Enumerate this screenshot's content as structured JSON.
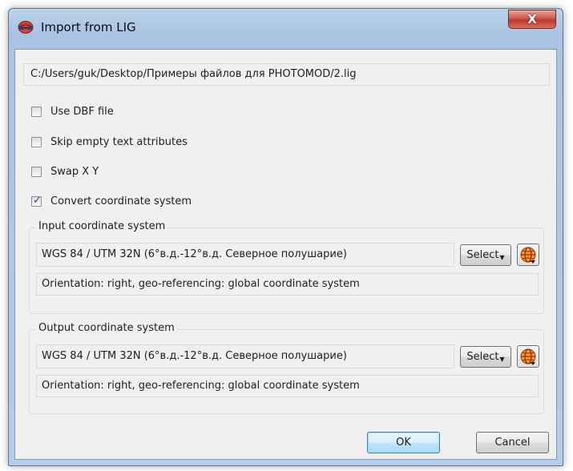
{
  "window": {
    "title": "Import from LIG",
    "close_label": "X"
  },
  "file": {
    "path": "C:/Users/guk/Desktop/Примеры файлов для PHOTOMOD/2.lig"
  },
  "options": [
    {
      "label": "Use DBF file",
      "checked": false
    },
    {
      "label": "Skip empty text attributes",
      "checked": false
    },
    {
      "label": "Swap X Y",
      "checked": false
    },
    {
      "label": "Convert coordinate system",
      "checked": true
    }
  ],
  "input_cs": {
    "group_label": "Input coordinate system",
    "value": "WGS 84 / UTM 32N (6°в.д.-12°в.д. Северное полушарие)",
    "select_label": "Select",
    "info": "Orientation: right, geo-referencing: global coordinate system"
  },
  "output_cs": {
    "group_label": "Output coordinate system",
    "value": "WGS 84 / UTM 32N (6°в.д.-12°в.д. Северное полушарие)",
    "select_label": "Select",
    "info": "Orientation: right, geo-referencing: global coordinate system"
  },
  "buttons": {
    "ok": "OK",
    "cancel": "Cancel"
  },
  "colors": {
    "accent": "#3c7fb1",
    "check": "#2a4a8f",
    "close": "#c2372a"
  },
  "icons": {
    "app": "red-glasses-icon",
    "globe": "globe-icon",
    "close": "close-icon"
  }
}
